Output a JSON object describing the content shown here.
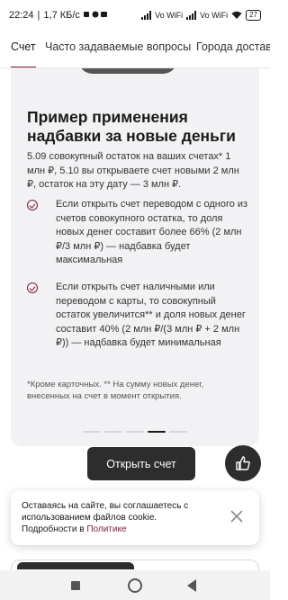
{
  "status_bar": {
    "time": "22:24",
    "speed": "1,7 КБ/с",
    "net1": "Vo WiFi",
    "net2": "Vo WiFi",
    "battery": "27"
  },
  "tabs": [
    {
      "label": "Счет",
      "active": true
    },
    {
      "label": "Часто задаваемые вопросы",
      "active": false
    },
    {
      "label": "Города доставки",
      "active": false
    }
  ],
  "card": {
    "title": "Пример применения надбавки за новые деньги",
    "intro": "5.09 совокупный остаток на ваших счетах* 1 млн ₽, 5.10 вы открываете счет новыми 2 млн ₽, остаток на эту дату — 3 млн ₽.",
    "bullets": [
      "Если открыть счет переводом с одного из счетов совокупного остатка, то доля новых денег составит более 66% (2 млн ₽/3 млн ₽) — надбавка будет максимальная",
      "Если открыть счет наличными или переводом с карты, то совокупный остаток увеличится** и доля новых денег составит 40% (2 млн ₽/(3 млн ₽ + 2 млн ₽)) — надбавка будет минимальная"
    ],
    "footnote": "*Кроме карточных. ** На сумму новых денег, внесенных на счет в момент открытия.",
    "carousel": {
      "count": 5,
      "active_index": 3
    }
  },
  "open_button": {
    "label": "Открыть счет"
  },
  "cookie": {
    "text": "Оставаясь на сайте, вы соглашаетесь с использованием файлов cookie. Подробности в ",
    "link": "Политике"
  },
  "colors": {
    "accent": "#7a1f3d",
    "dark_button": "#2d2d2d",
    "card_bg": "#f2f2f4"
  },
  "icons": [
    "thumbs-up-icon",
    "close-icon",
    "check-circle-icon"
  ]
}
